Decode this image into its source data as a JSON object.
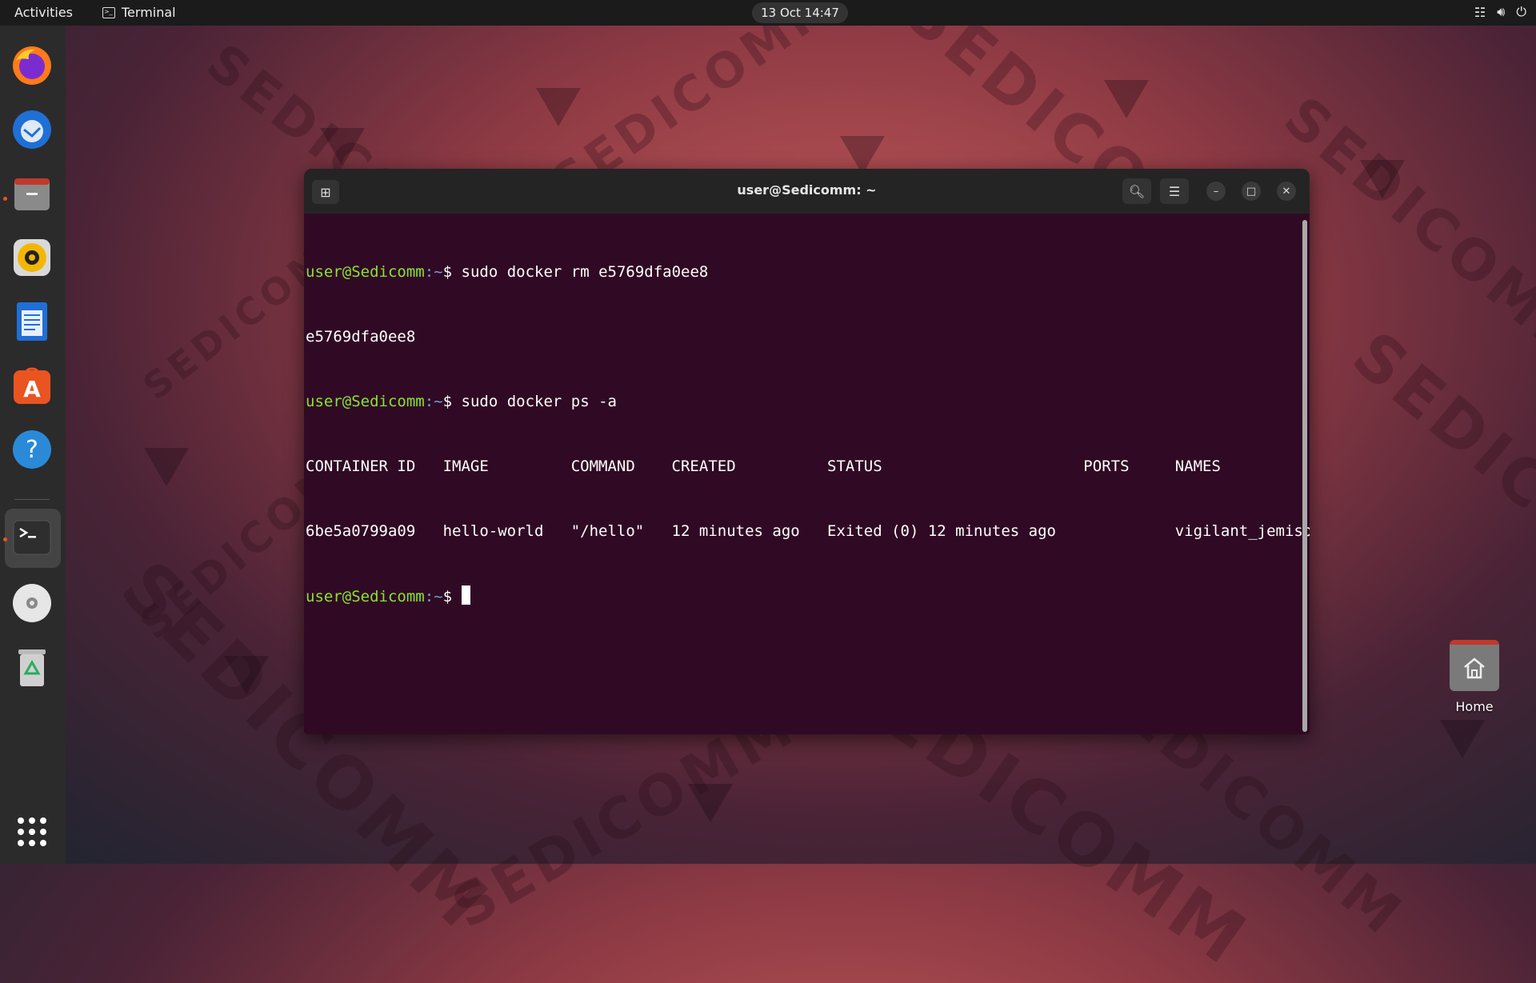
{
  "topbar": {
    "activities": "Activities",
    "app_name": "Terminal",
    "clock": "13 Oct  14:47",
    "tray_icons": [
      "network-icon",
      "volume-icon",
      "power-icon"
    ]
  },
  "dock": {
    "items": [
      "firefox",
      "thunderbird",
      "files",
      "rhythmbox",
      "libreoffice-writer",
      "app-center",
      "help",
      "terminal",
      "disc",
      "trash",
      "show-apps"
    ]
  },
  "terminal": {
    "title": "user@Sedicomm: ~",
    "prompt_user": "user@Sedicomm",
    "prompt_path": ":~",
    "prompt_symbol": "$ ",
    "line1_cmd": "sudo docker rm e5769dfa0ee8",
    "line2_out": "e5769dfa0ee8",
    "line3_cmd": "sudo docker ps -a",
    "table_header": "CONTAINER ID   IMAGE         COMMAND    CREATED          STATUS                      PORTS     NAMES",
    "table_row": "6be5a0799a09   hello-world   \"/hello\"   12 minutes ago   Exited (0) 12 minutes ago             vigilant_jemison"
  },
  "desktop": {
    "home_label": "Home"
  },
  "watermark": "SEDICOMM"
}
